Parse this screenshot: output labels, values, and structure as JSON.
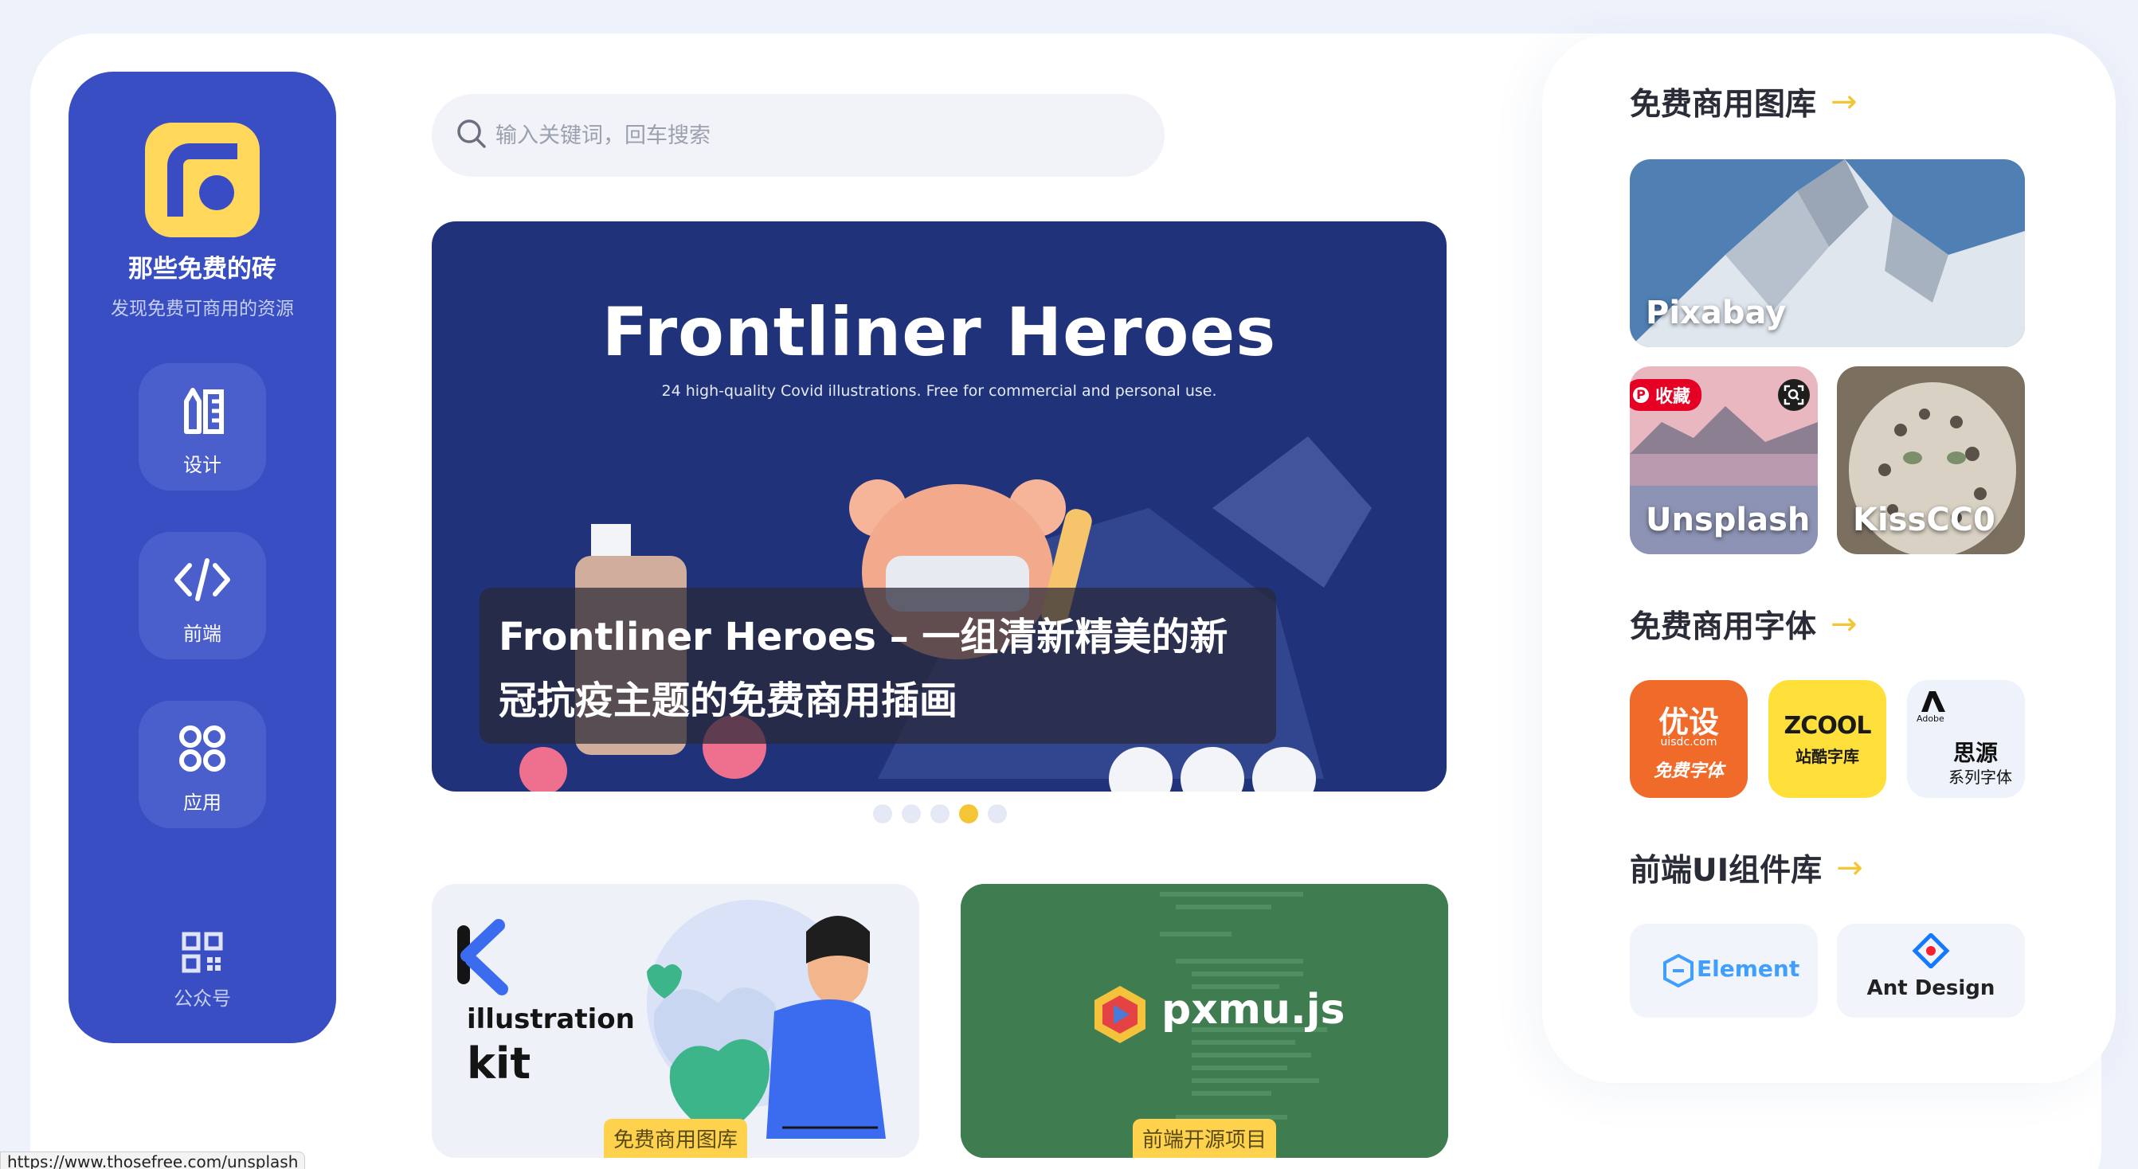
{
  "brand": {
    "title": "那些免费的砖",
    "subtitle": "发现免费可商用的资源"
  },
  "nav": [
    {
      "label": "设计"
    },
    {
      "label": "前端"
    },
    {
      "label": "应用"
    }
  ],
  "qr": {
    "label": "公众号"
  },
  "search": {
    "placeholder": "输入关键词，回车搜索"
  },
  "hero": {
    "title": "Frontliner Heroes",
    "subtitle": "24 high-quality Covid illustrations. Free for commercial and personal use.",
    "caption": "Frontliner Heroes – 一组清新精美的新冠抗疫主题的免费商用插画",
    "slides": 5,
    "active_slide": 4
  },
  "cards": [
    {
      "tag": "免费商用图库",
      "line1": "illustration",
      "line2": "kit"
    },
    {
      "tag": "前端开源项目",
      "logo_text": "pxmu.js"
    }
  ],
  "right": {
    "images_title": "免费商用图库",
    "images": [
      {
        "label": "Pixabay"
      },
      {
        "label": "Unsplash"
      },
      {
        "label": "KissCC0"
      }
    ],
    "save_badge": "收藏",
    "fonts_title": "免费商用字体",
    "fonts": [
      {
        "title": "优设",
        "domain": "uisdc.com",
        "sub": "免费字体",
        "color": "#f06a2a"
      },
      {
        "title": "ZCOOL",
        "sub": "站酷字库",
        "color": "#ffe03a"
      },
      {
        "brand": "Adobe",
        "title": "思源",
        "sub": "系列字体",
        "color": "#eef2fa"
      }
    ],
    "ui_title": "前端UI组件库",
    "ui": [
      {
        "label": "Element"
      },
      {
        "label": "Ant Design"
      }
    ]
  },
  "status_url": "https://www.thosefree.com/unsplash",
  "colors": {
    "primary": "#394ec3",
    "accent": "#f4c636",
    "background": "#eef2fb"
  }
}
